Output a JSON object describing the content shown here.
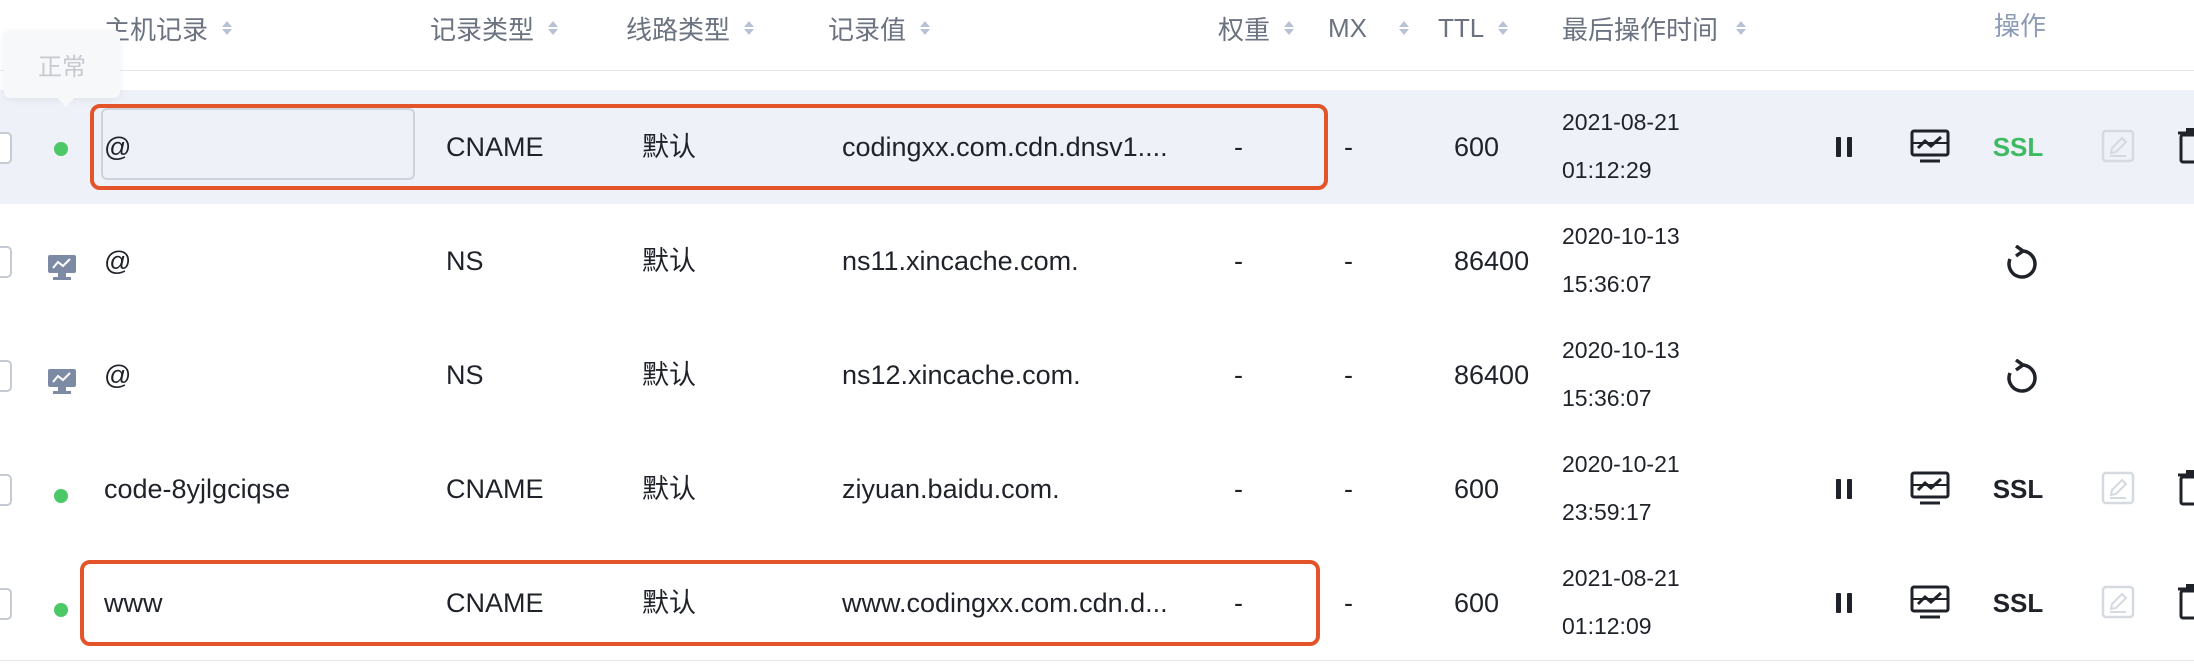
{
  "colors": {
    "status_ok": "#4cc866",
    "ssl_active": "#3dbb63",
    "highlight_border": "#e4542b",
    "header_text": "#6b7280",
    "row_highlight_bg": "#eef1f8"
  },
  "table": {
    "headers": {
      "host": "主机记录",
      "type": "记录类型",
      "line": "线路类型",
      "value": "记录值",
      "weight": "权重",
      "mx": "MX",
      "ttl": "TTL",
      "updated": "最后操作时间",
      "actions": "操作"
    },
    "tooltip": "正常",
    "rows": [
      {
        "status": "normal",
        "status_icon": "green-dot",
        "host": "@",
        "type": "CNAME",
        "line": "默认",
        "value": "codingxx.com.cdn.dnsv1....",
        "weight": "-",
        "mx": "-",
        "ttl": "600",
        "date": "2021-08-21",
        "time": "01:12:29",
        "actions": [
          "pause-icon",
          "monitor-icon",
          "SSL",
          "edit-icon",
          "delete-icon"
        ]
      },
      {
        "status": "system",
        "status_icon": "server-icon",
        "host": "@",
        "type": "NS",
        "line": "默认",
        "value": "ns11.xincache.com.",
        "weight": "-",
        "mx": "-",
        "ttl": "86400",
        "date": "2020-10-13",
        "time": "15:36:07",
        "actions": [
          "refresh-icon"
        ]
      },
      {
        "status": "system",
        "status_icon": "server-icon",
        "host": "@",
        "type": "NS",
        "line": "默认",
        "value": "ns12.xincache.com.",
        "weight": "-",
        "mx": "-",
        "ttl": "86400",
        "date": "2020-10-13",
        "time": "15:36:07",
        "actions": [
          "refresh-icon"
        ]
      },
      {
        "status": "normal",
        "status_icon": "green-dot",
        "host": "code-8yjlgciqse",
        "type": "CNAME",
        "line": "默认",
        "value": "ziyuan.baidu.com.",
        "weight": "-",
        "mx": "-",
        "ttl": "600",
        "date": "2020-10-21",
        "time": "23:59:17",
        "actions": [
          "pause-icon",
          "monitor-icon",
          "SSL",
          "edit-icon",
          "delete-icon"
        ]
      },
      {
        "status": "normal",
        "status_icon": "green-dot",
        "host": "www",
        "type": "CNAME",
        "line": "默认",
        "value": "www.codingxx.com.cdn.d...",
        "weight": "-",
        "mx": "-",
        "ttl": "600",
        "date": "2021-08-21",
        "time": "01:12:09",
        "actions": [
          "pause-icon",
          "monitor-icon",
          "SSL",
          "edit-icon",
          "delete-icon"
        ]
      }
    ],
    "ssl_label": "SSL"
  }
}
